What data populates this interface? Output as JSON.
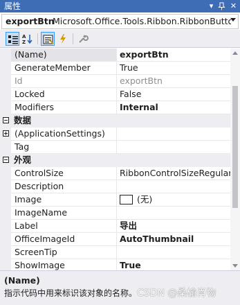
{
  "window": {
    "title": "属性",
    "buttons": {
      "dropdown": "▾",
      "pin": "ᚕ",
      "close": "✕"
    }
  },
  "object_selector": {
    "name": "exportBtn",
    "type": "Microsoft.Office.Tools.Ribbon.RibbonButton"
  },
  "toolbar": {
    "buttons": [
      "categorized-view-icon",
      "alphabetical-sort-icon",
      "properties-icon",
      "events-lightning-icon",
      "property-pages-wrench-icon"
    ]
  },
  "grid": {
    "rows": [
      {
        "kind": "prop",
        "name": "(Name)",
        "value": "exportBtn",
        "bold": true,
        "selected": true
      },
      {
        "kind": "prop",
        "name": "GenerateMember",
        "value": "True"
      },
      {
        "kind": "prop",
        "name": "Id",
        "value": "exportBtn",
        "readonly": true
      },
      {
        "kind": "prop",
        "name": "Locked",
        "value": "False"
      },
      {
        "kind": "prop",
        "name": "Modifiers",
        "value": "Internal",
        "bold": true
      },
      {
        "kind": "cat",
        "label": "数据",
        "expanded": true
      },
      {
        "kind": "prop",
        "name": "(ApplicationSettings)",
        "value": "",
        "expandable": true
      },
      {
        "kind": "prop",
        "name": "Tag",
        "value": ""
      },
      {
        "kind": "cat",
        "label": "外观",
        "expanded": true
      },
      {
        "kind": "prop",
        "name": "ControlSize",
        "value": "RibbonControlSizeRegular"
      },
      {
        "kind": "prop",
        "name": "Description",
        "value": ""
      },
      {
        "kind": "prop",
        "name": "Image",
        "value": "(无)",
        "swatch": true
      },
      {
        "kind": "prop",
        "name": "ImageName",
        "value": ""
      },
      {
        "kind": "prop",
        "name": "Label",
        "value": "导出",
        "bold": true
      },
      {
        "kind": "prop",
        "name": "OfficeImageId",
        "value": "AutoThumbnail",
        "bold": true
      },
      {
        "kind": "prop",
        "name": "ScreenTip",
        "value": ""
      },
      {
        "kind": "prop",
        "name": "ShowImage",
        "value": "True",
        "bold": true
      }
    ]
  },
  "description": {
    "title": "(Name)",
    "text": "指示代码中用来标识该对象的名称。"
  },
  "watermark": "CSDN @桑榆肖物",
  "colors": {
    "titlebar": "#3e6db5",
    "panel": "#eeeef2",
    "grid_line": "#e7e8ec",
    "selection": "#e3e3e8",
    "active_tool": "#c9def5"
  }
}
